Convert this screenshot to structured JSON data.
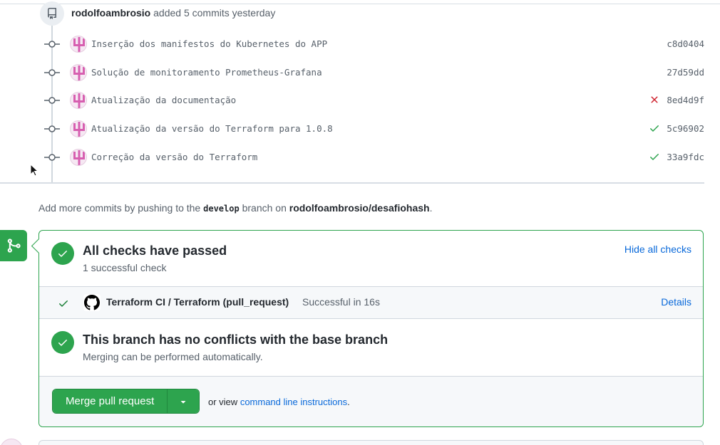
{
  "push_event": {
    "author": "rodolfoambrosio",
    "action": "added 5 commits yesterday"
  },
  "commits": [
    {
      "message": "Inserção dos manifestos do Kubernetes do APP",
      "sha": "c8d0404",
      "status": "none"
    },
    {
      "message": "Solução de monitoramento Prometheus-Grafana",
      "sha": "27d59dd",
      "status": "none"
    },
    {
      "message": "Atualização da documentação",
      "sha": "8ed4d9f",
      "status": "failure"
    },
    {
      "message": "Atualização da versão do Terraform para 1.0.8",
      "sha": "5c96902",
      "status": "success"
    },
    {
      "message": "Correção da versão do Terraform",
      "sha": "33a9fdc",
      "status": "success"
    }
  ],
  "hint": {
    "prefix": "Add more commits by pushing to the",
    "branch": "develop",
    "middle": "branch on",
    "repo": "rodolfoambrosio/desafiohash",
    "suffix": "."
  },
  "checks": {
    "title": "All checks have passed",
    "subtitle": "1 successful check",
    "toggle_label": "Hide all checks",
    "items": [
      {
        "name": "Terraform CI / Terraform (pull_request)",
        "status": "Successful in 16s",
        "details_label": "Details"
      }
    ]
  },
  "conflicts": {
    "title": "This branch has no conflicts with the base branch",
    "subtitle": "Merging can be performed automatically."
  },
  "merge": {
    "button_label": "Merge pull request",
    "or_view": "or view",
    "cli_link": "command line instructions",
    "cli_suffix": "."
  },
  "colors": {
    "success": "#2da44e",
    "failure": "#cf222e",
    "link": "#0969da"
  }
}
